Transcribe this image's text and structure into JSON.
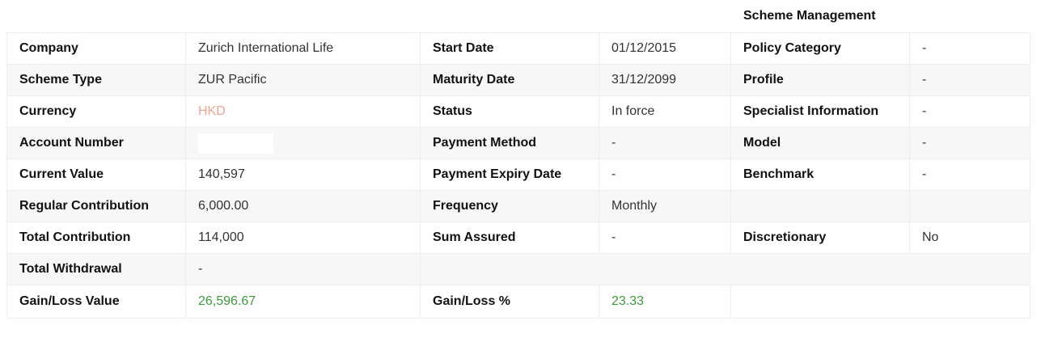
{
  "section_heading": "Scheme Management",
  "colors": {
    "currency_accent": "#e8a58c",
    "gain_positive": "#3a9b3a"
  },
  "rows": [
    {
      "c1_label": "Company",
      "c1_value": "Zurich International Life",
      "c2_label": "Start Date",
      "c2_value": "01/12/2015",
      "c3_label": "Policy Category",
      "c3_value": "-"
    },
    {
      "c1_label": "Scheme Type",
      "c1_value": "ZUR Pacific",
      "c2_label": "Maturity Date",
      "c2_value": "31/12/2099",
      "c3_label": "Profile",
      "c3_value": "-"
    },
    {
      "c1_label": "Currency",
      "c1_value": "HKD",
      "c2_label": "Status",
      "c2_value": "In force",
      "c3_label": "Specialist Information",
      "c3_value": "-"
    },
    {
      "c1_label": "Account Number",
      "c1_value": "",
      "c2_label": "Payment Method",
      "c2_value": "-",
      "c3_label": "Model",
      "c3_value": "-"
    },
    {
      "c1_label": "Current Value",
      "c1_value": "140,597",
      "c2_label": "Payment Expiry Date",
      "c2_value": "-",
      "c3_label": "Benchmark",
      "c3_value": "-"
    },
    {
      "c1_label": "Regular Contribution",
      "c1_value": "6,000.00",
      "c2_label": "Frequency",
      "c2_value": "Monthly",
      "c3_label": "",
      "c3_value": ""
    },
    {
      "c1_label": "Total Contribution",
      "c1_value": "114,000",
      "c2_label": "Sum Assured",
      "c2_value": "-",
      "c3_label": "Discretionary",
      "c3_value": "No"
    },
    {
      "c1_label": "Total Withdrawal",
      "c1_value": "-"
    },
    {
      "c1_label": "Gain/Loss Value",
      "c1_value": "26,596.67",
      "c2_label": "Gain/Loss %",
      "c2_value": "23.33"
    }
  ]
}
